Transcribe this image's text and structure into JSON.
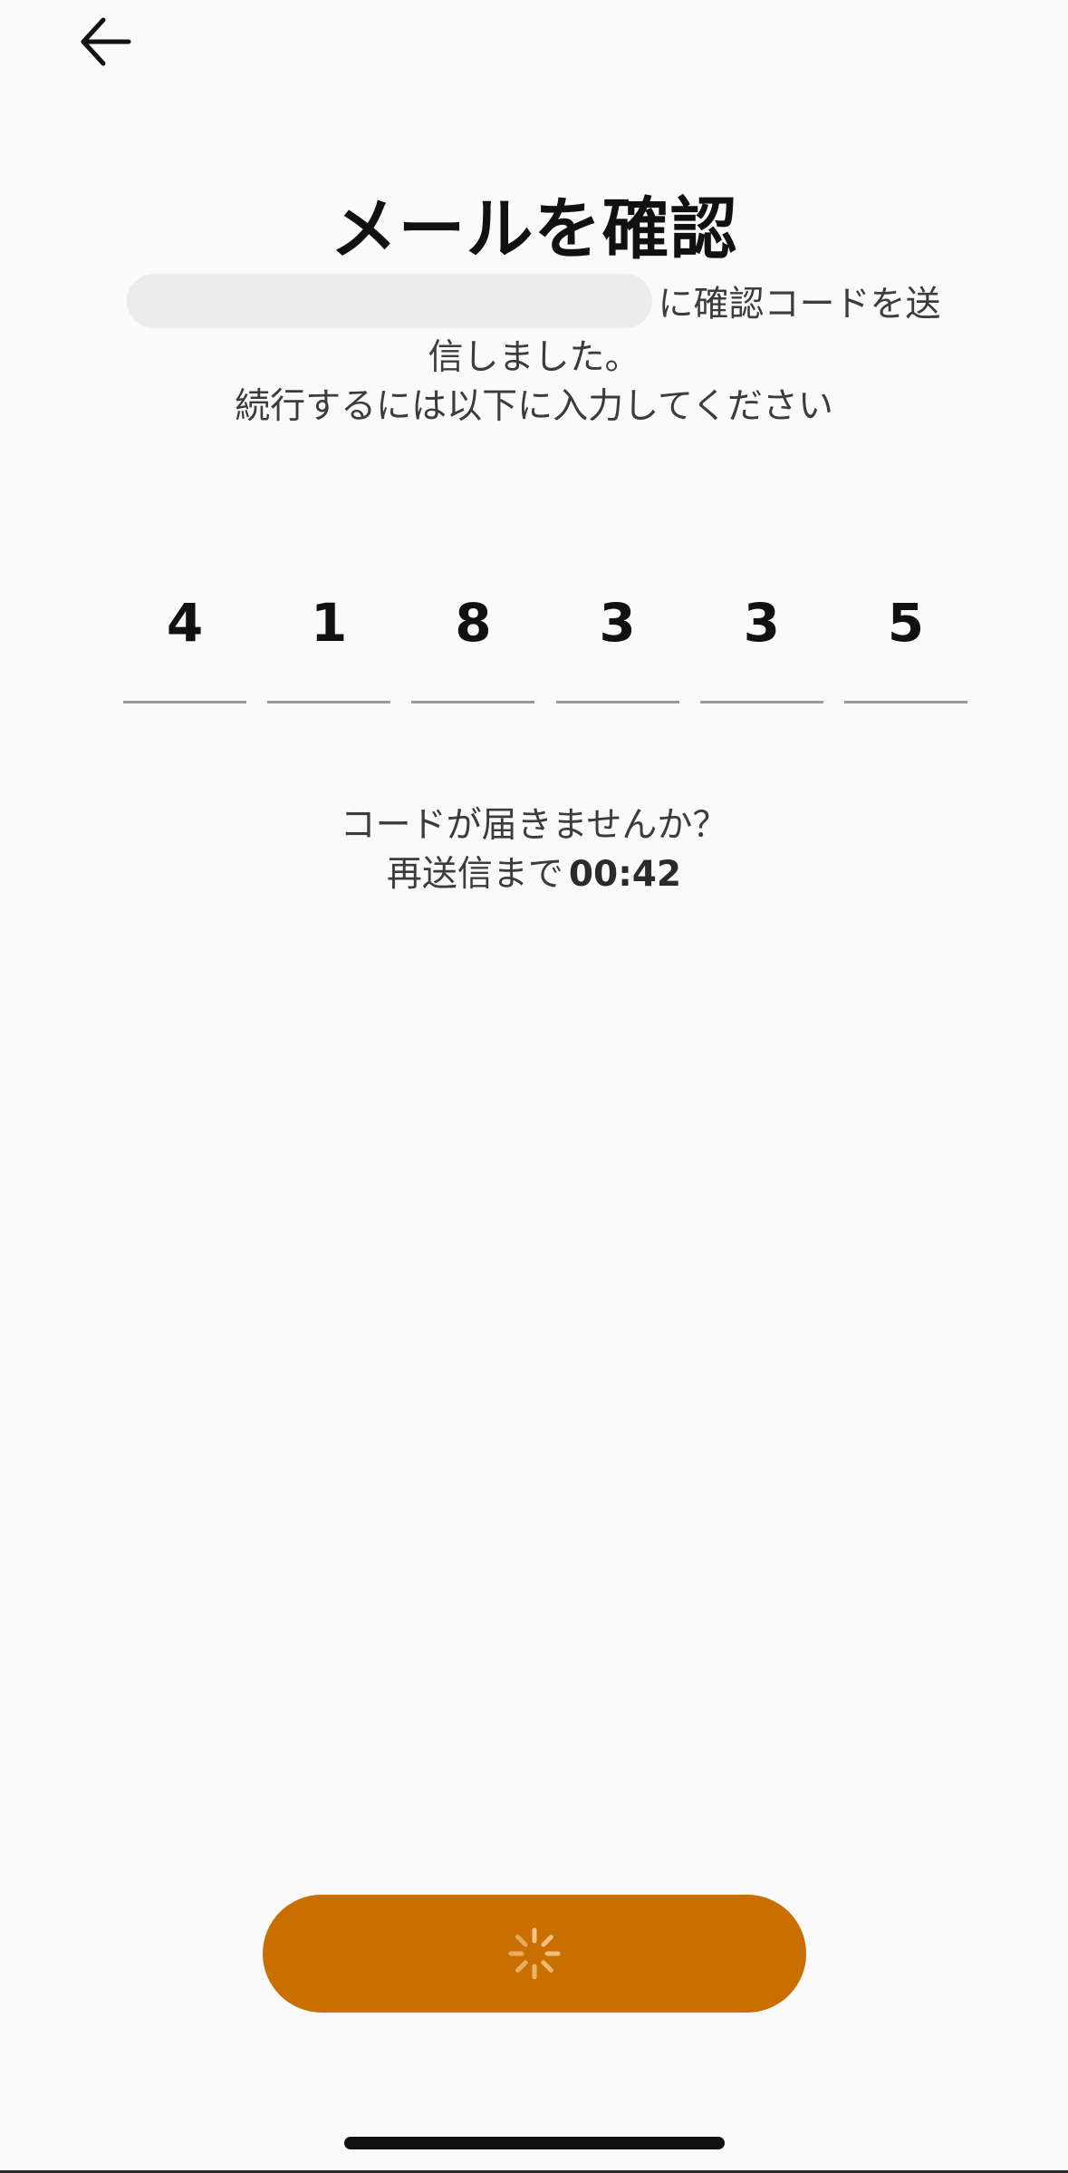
{
  "header": {
    "back_icon": "arrow-left-icon"
  },
  "title": "メールを確認",
  "subtitle": {
    "line1_suffix": "に確認コードを送",
    "line2": "信しました。",
    "line3": "続行するには以下に入力してください"
  },
  "code": {
    "digits": [
      "4",
      "1",
      "8",
      "3",
      "3",
      "5"
    ]
  },
  "resend": {
    "question": "コードが届きませんか？",
    "prefix": "再送信まで",
    "timer": "00:42"
  },
  "submit": {
    "state_icon": "loading-spinner-icon"
  },
  "colors": {
    "accent": "#c86f00",
    "background": "#fafafa",
    "text": "#3c3c3c",
    "title": "#111111"
  }
}
